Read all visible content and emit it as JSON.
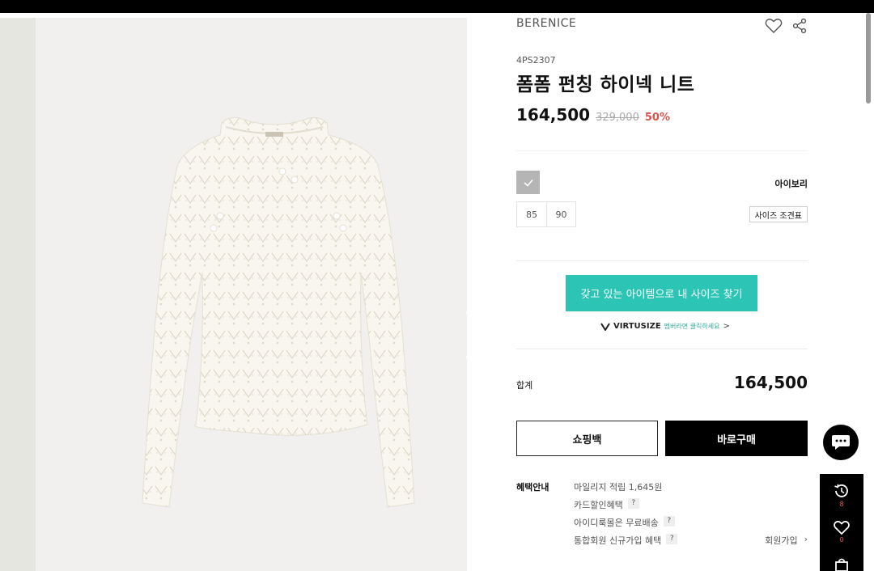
{
  "product": {
    "brand": "BERENICE",
    "code": "4PS2307",
    "name": "폼폼 펀칭 하이넥 니트",
    "price": "164,500",
    "original_price": "329,000",
    "discount": "50%"
  },
  "options": {
    "color_name": "아이보리",
    "sizes": [
      "85",
      "90"
    ],
    "size_chart_label": "사이즈 조견표"
  },
  "virtusize": {
    "button_label": "갖고 있는 아이템으로 내 사이즈 찾기",
    "logo": "VIRTUSIZE",
    "note": "멤버라면 클릭하세요",
    "arrow": ">"
  },
  "total": {
    "label": "합계",
    "value": "164,500"
  },
  "actions": {
    "cart_label": "쇼핑백",
    "buy_label": "바로구매"
  },
  "benefits": {
    "title": "혜택안내",
    "items": [
      {
        "text": "마일리지 적립 1,645원",
        "help": ""
      },
      {
        "text": "카드할인혜택",
        "help": "?"
      },
      {
        "text": "아이디룩몰은 무료배송",
        "help": "?"
      },
      {
        "text": "통합회원 신규가입 혜택",
        "help": "?"
      }
    ],
    "join_label": "회원가입",
    "join_arrow": "›"
  },
  "quickbar": {
    "recent_count": "8",
    "wish_count": "0"
  },
  "icons": {
    "wishlist": "heart-icon",
    "share": "share-icon",
    "next": "chevron-right-icon",
    "chat": "chat-bubble-icon",
    "recent": "history-icon",
    "cart": "shopping-bag-icon"
  },
  "colors": {
    "accent": "#2cc4b4",
    "discount": "#d9534f",
    "swatch": "#b5b5b5"
  }
}
